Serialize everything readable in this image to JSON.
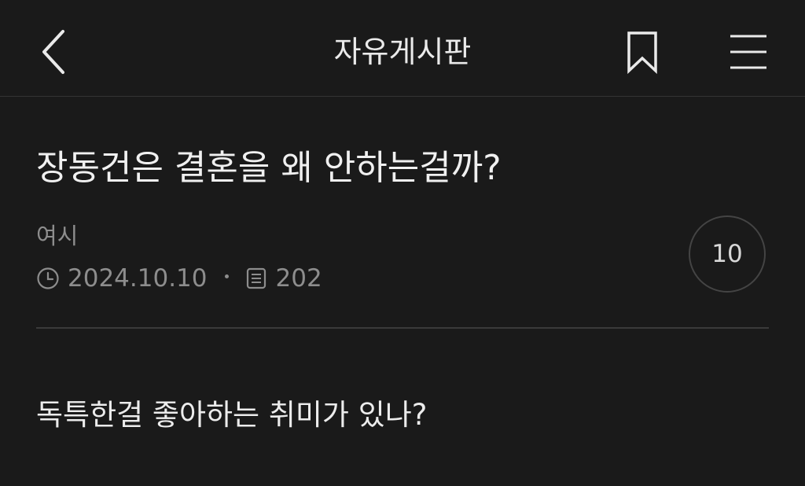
{
  "header": {
    "title": "자유게시판",
    "back_icon": "chevron-left-icon",
    "bookmark_icon": "bookmark-icon",
    "menu_icon": "hamburger-menu-icon"
  },
  "post": {
    "title": "장동건은 결혼을 왜 안하는걸까?",
    "author": "여시",
    "date": "2024.10.10",
    "views": "202",
    "comment_count": "10",
    "body": "독특한걸 좋아하는 취미가 있나?"
  },
  "colors": {
    "background": "#1a1a1a",
    "text_primary": "#f0f0f0",
    "text_secondary": "#8d8d8d",
    "divider": "#3a3a3a"
  }
}
